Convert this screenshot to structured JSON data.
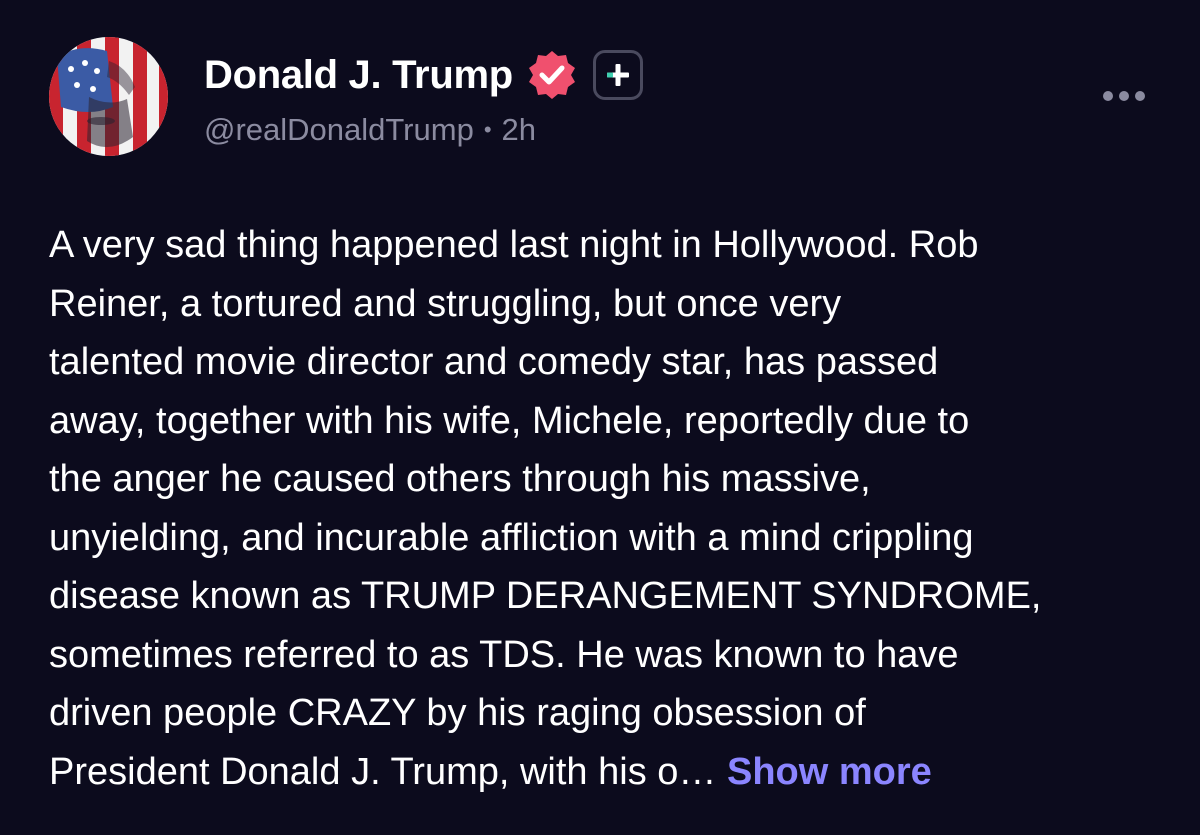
{
  "author": {
    "display_name": "Donald J. Trump",
    "handle": "@realDonaldTrump",
    "time_ago": "2h",
    "separator": "•",
    "verified_icon": "verified-badge-icon",
    "plus_icon": "plus-icon"
  },
  "post": {
    "lines": [
      "A very sad thing happened last night in Hollywood. Rob",
      "Reiner, a tortured and struggling, but once very",
      "talented movie director and comedy star, has passed",
      "away, together with his wife, Michele, reportedly due to",
      "the anger he caused others through his massive,",
      "unyielding, and incurable affliction with a mind crippling",
      "disease known as TRUMP DERANGEMENT SYNDROME,",
      "sometimes referred to as TDS. He was known to have",
      "driven people CRAZY by his raging obsession of",
      "President Donald J. Trump, with his o…"
    ],
    "show_more_label": "Show more"
  },
  "menu": {
    "more_icon": "more-options-icon"
  },
  "colors": {
    "background": "#0c0b1d",
    "text": "#ffffff",
    "muted": "#8b8ba0",
    "accent": "#8b85ff",
    "verified": "#f0506e"
  }
}
